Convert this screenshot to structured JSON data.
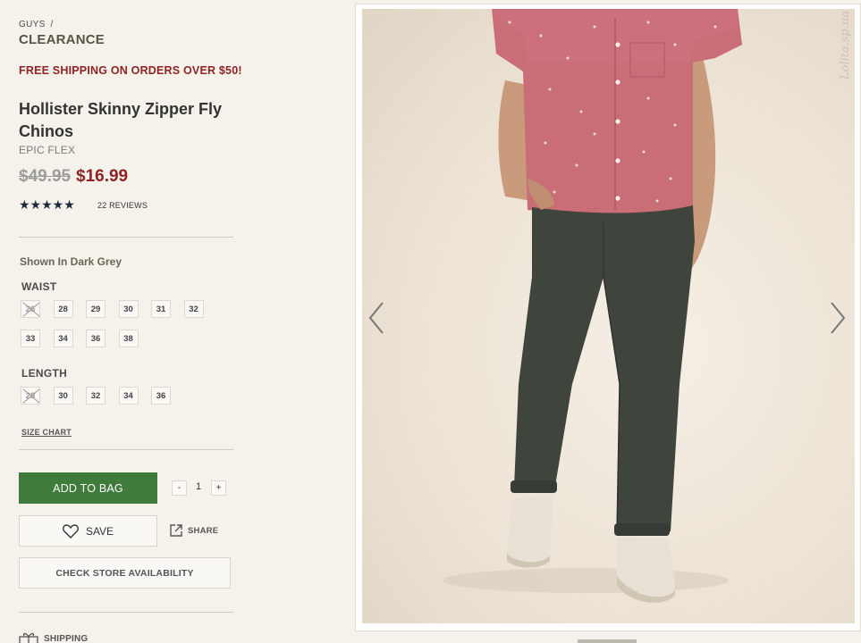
{
  "breadcrumb": {
    "parent": "GUYS",
    "separator": "/",
    "current": "CLEARANCE"
  },
  "promo": "FREE SHIPPING ON ORDERS OVER $50!",
  "product": {
    "title": "Hollister Skinny Zipper Fly Chinos",
    "subtitle": "EPIC FLEX",
    "price_old": "$49.95",
    "price_new": "$16.99",
    "stars": "★★★★★",
    "rating": 5,
    "reviews": "22 REVIEWS"
  },
  "color": {
    "label": "Shown In Dark Grey"
  },
  "waist": {
    "label": "WAIST",
    "sizes": [
      "26",
      "28",
      "29",
      "30",
      "31",
      "32",
      "33",
      "34",
      "36",
      "38"
    ],
    "unavailable": [
      "26"
    ]
  },
  "length": {
    "label": "LENGTH",
    "sizes": [
      "28",
      "30",
      "32",
      "34",
      "36"
    ],
    "unavailable": [
      "28"
    ]
  },
  "size_chart": "SIZE CHART",
  "actions": {
    "add_to_bag": "ADD TO BAG",
    "qty_minus": "-",
    "quantity": "1",
    "qty_plus": "+",
    "save": "SAVE",
    "share": "SHARE",
    "check_store": "CHECK STORE AVAILABILITY",
    "shipping": "SHIPPING"
  },
  "gallery": {
    "watermark": "Lolita.sp.ua"
  },
  "colors": {
    "promo": "#8f2424",
    "price_sale": "#8e2424",
    "add_to_bag": "#3f7b3a",
    "stars": "#1d2a3a"
  }
}
